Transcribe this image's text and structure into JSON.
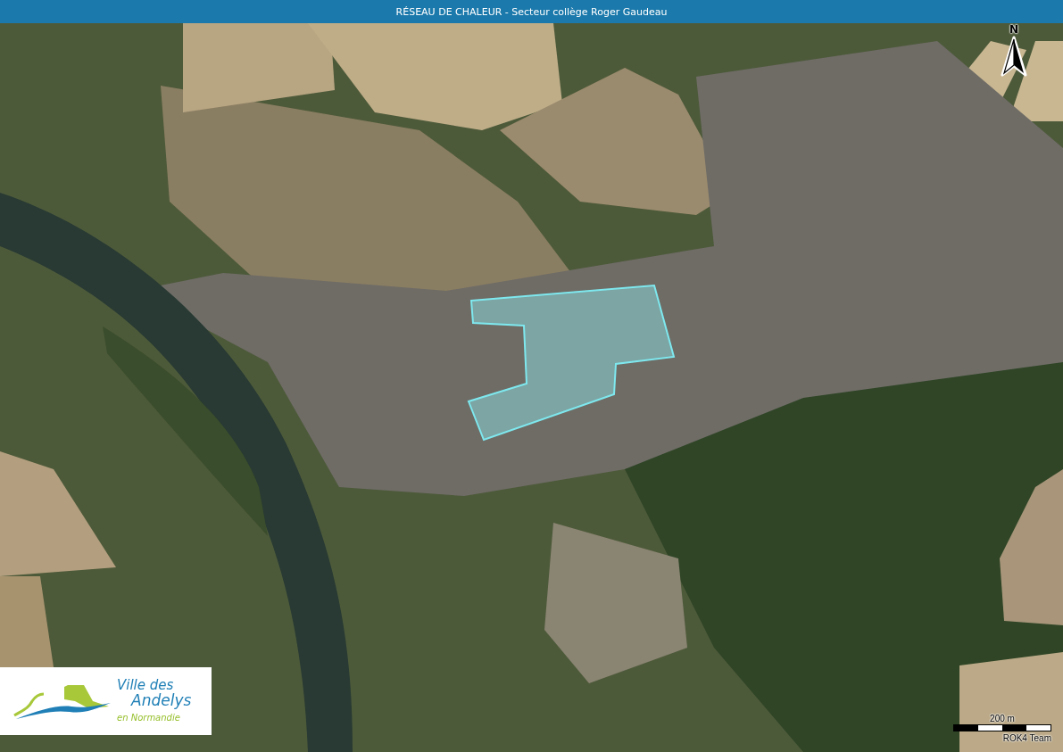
{
  "header": {
    "title": "RÉSEAU DE CHALEUR - Secteur collège Roger Gaudeau"
  },
  "map": {
    "north_label": "N",
    "logo": {
      "line1": "Ville des",
      "line2": "Andelys",
      "line3": "en Normandie"
    },
    "scale": {
      "label": "200 m"
    },
    "attribution": "ROK4 Team"
  }
}
